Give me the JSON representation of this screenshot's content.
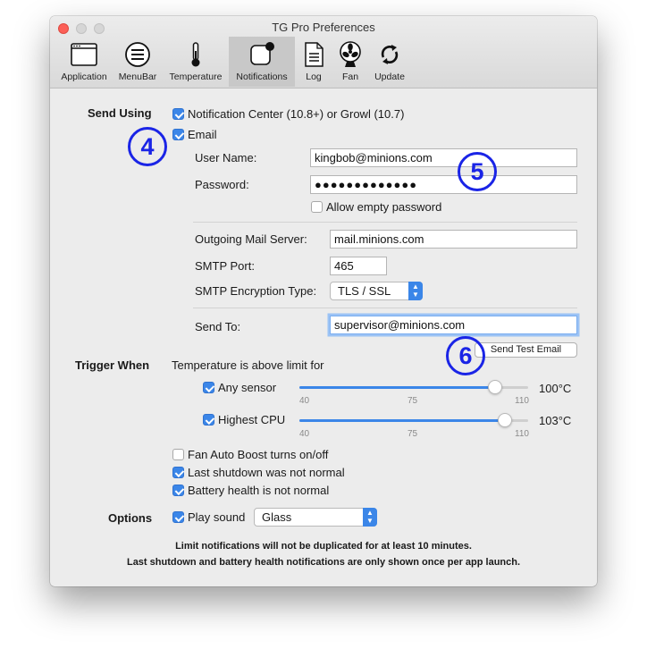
{
  "window": {
    "title": "TG Pro Preferences"
  },
  "toolbar": [
    {
      "label": "Application",
      "icon": "application-window-icon"
    },
    {
      "label": "MenuBar",
      "icon": "menubar-icon"
    },
    {
      "label": "Temperature",
      "icon": "thermometer-icon"
    },
    {
      "label": "Notifications",
      "icon": "notifications-icon",
      "selected": true
    },
    {
      "label": "Log",
      "icon": "log-document-icon"
    },
    {
      "label": "Fan",
      "icon": "fan-icon"
    },
    {
      "label": "Update",
      "icon": "update-arrows-icon"
    }
  ],
  "send_using": {
    "label": "Send Using",
    "notification_center": {
      "label": "Notification Center (10.8+) or Growl (10.7)",
      "checked": true
    },
    "email": {
      "label": "Email",
      "checked": true
    },
    "username": {
      "label": "User Name:",
      "value": "kingbob@minions.com"
    },
    "password": {
      "label": "Password:",
      "value": "●●●●●●●●●●●●●"
    },
    "allow_empty": {
      "label": "Allow empty password",
      "checked": false
    },
    "mail_server": {
      "label": "Outgoing Mail Server:",
      "value": "mail.minions.com"
    },
    "smtp_port": {
      "label": "SMTP Port:",
      "value": "465"
    },
    "encryption": {
      "label": "SMTP Encryption Type:",
      "value": "TLS / SSL"
    },
    "send_to": {
      "label": "Send To:",
      "value": "supervisor@minions.com"
    },
    "test_button": "Send Test Email"
  },
  "trigger_when": {
    "label": "Trigger When",
    "description": "Temperature is above limit for",
    "any_sensor": {
      "label": "Any sensor",
      "checked": true,
      "value": 100,
      "display": "100°C",
      "min": 40,
      "mid": 75,
      "max": 110,
      "ticks": [
        "40",
        "75",
        "110"
      ]
    },
    "highest_cpu": {
      "label": "Highest CPU",
      "checked": true,
      "value": 103,
      "display": "103°C",
      "min": 40,
      "mid": 75,
      "max": 110,
      "ticks": [
        "40",
        "75",
        "110"
      ]
    },
    "fan_boost": {
      "label": "Fan Auto Boost turns on/off",
      "checked": false
    },
    "last_shutdown": {
      "label": "Last shutdown was not normal",
      "checked": true
    },
    "battery_health": {
      "label": "Battery health is not normal",
      "checked": true
    }
  },
  "options": {
    "label": "Options",
    "play_sound": {
      "label": "Play sound",
      "checked": true
    },
    "sound": "Glass"
  },
  "notes": [
    "Limit notifications will not be duplicated for at least 10 minutes.",
    "Last shutdown and battery health notifications are only shown once per app launch."
  ],
  "annotations": [
    "4",
    "5",
    "6"
  ],
  "colors": {
    "accent": "#3b86e8",
    "annotation": "#1a24e6",
    "close": "#fc5f57"
  }
}
